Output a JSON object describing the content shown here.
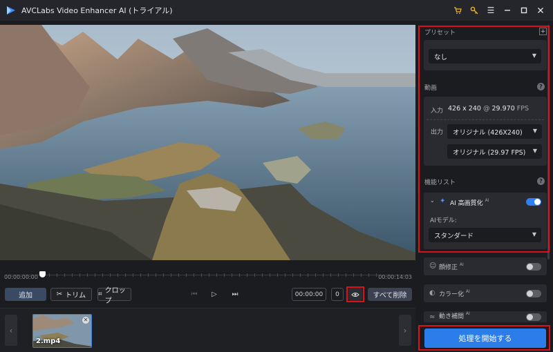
{
  "window": {
    "title": "AVCLabs Video Enhancer AI (トライアル)"
  },
  "timeline": {
    "start_time": "00:00:00:00",
    "end_time": "00:00:14:03",
    "position": 0.0
  },
  "toolbar": {
    "add_label": "追加",
    "trim_label": "トリム",
    "crop_label": "クロップ",
    "current_time": "00:00:00",
    "frame": "0",
    "clear_all_label": "すべて削除"
  },
  "files": [
    {
      "name": "2.mp4"
    }
  ],
  "panel": {
    "preset_label": "プリセット",
    "preset_value": "なし",
    "video_label": "動画",
    "input_label": "入力",
    "input_resolution": "426 x 240",
    "input_at": "@",
    "input_fps": "29.970",
    "input_fps_unit": "FPS",
    "output_label": "出力",
    "output_resolution": "オリジナル (426X240)",
    "output_fps": "オリジナル (29.97 FPS)",
    "feature_list_label": "機能リスト",
    "ai_feature_name": "AI 高画質化",
    "ai_sup": "AI",
    "ai_model_label": "AIモデル:",
    "ai_model_value": "スタンダード",
    "features": [
      {
        "name": "顔修正",
        "sup": "AI",
        "enabled": false
      },
      {
        "name": "カラー化",
        "sup": "AI",
        "enabled": false
      },
      {
        "name": "動き補間",
        "sup": "AI",
        "enabled": false
      }
    ],
    "start_label": "処理を開始する"
  },
  "colors": {
    "accent": "#2b7de9",
    "highlight": "#e0101b"
  }
}
